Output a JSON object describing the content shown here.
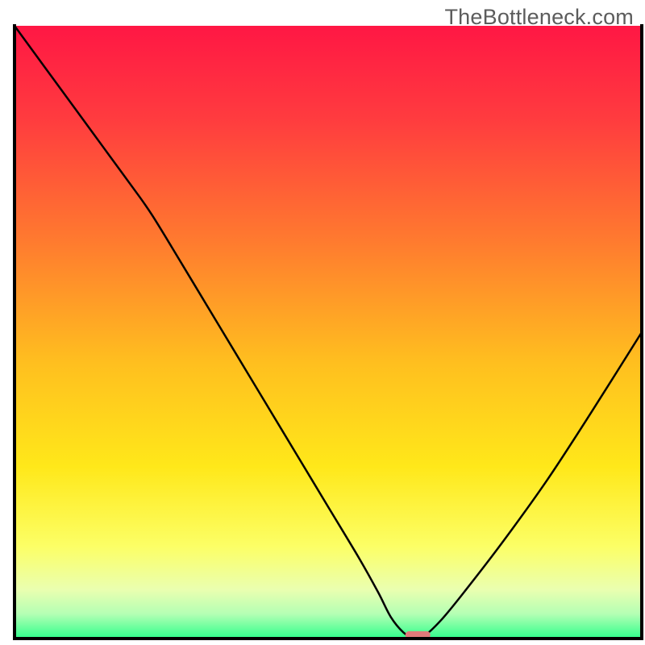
{
  "watermark": "TheBottleneck.com",
  "chart_data": {
    "type": "line",
    "title": "",
    "xlabel": "",
    "ylabel": "",
    "xlim": [
      0,
      100
    ],
    "ylim": [
      0,
      100
    ],
    "grid": false,
    "legend": false,
    "background_gradient": {
      "stops": [
        {
          "offset": 0.0,
          "color": "#ff1744"
        },
        {
          "offset": 0.15,
          "color": "#ff3b3f"
        },
        {
          "offset": 0.35,
          "color": "#ff7a2f"
        },
        {
          "offset": 0.55,
          "color": "#ffbf1f"
        },
        {
          "offset": 0.72,
          "color": "#ffe81a"
        },
        {
          "offset": 0.85,
          "color": "#fcff66"
        },
        {
          "offset": 0.92,
          "color": "#eaffb0"
        },
        {
          "offset": 0.96,
          "color": "#b4ffb4"
        },
        {
          "offset": 1.0,
          "color": "#2fff8c"
        }
      ]
    },
    "series": [
      {
        "name": "bottleneck-curve",
        "color": "#000000",
        "stroke_width": 2.5,
        "x": [
          0.0,
          5.0,
          10.0,
          15.0,
          20.0,
          22.0,
          25.0,
          30.0,
          35.0,
          40.0,
          45.0,
          50.0,
          55.0,
          58.0,
          60.0,
          62.0,
          63.5,
          65.0,
          68.0,
          72.0,
          78.0,
          85.0,
          92.0,
          100.0
        ],
        "y": [
          100.0,
          93.0,
          86.0,
          79.0,
          72.0,
          69.0,
          64.0,
          55.5,
          47.0,
          38.5,
          30.0,
          21.5,
          13.0,
          7.5,
          3.5,
          1.0,
          0.2,
          0.2,
          3.0,
          8.0,
          16.0,
          26.0,
          37.0,
          50.0
        ]
      }
    ],
    "marker": {
      "name": "optimal-range-marker",
      "shape": "rounded-rect",
      "color": "#e17a7a",
      "x_center": 64.3,
      "y": 0.6,
      "width_x_units": 4.0,
      "height_y_units": 1.2
    },
    "plot_border": {
      "left": true,
      "right": true,
      "bottom": true,
      "top": false,
      "color": "#000000",
      "width": 4
    }
  }
}
